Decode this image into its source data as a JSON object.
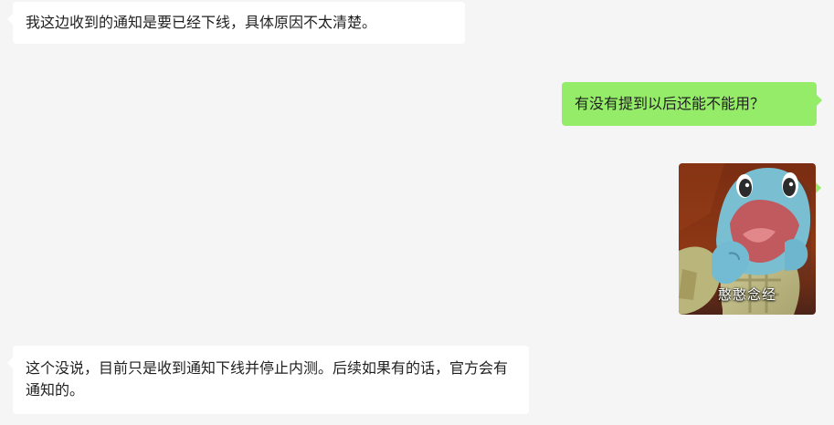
{
  "messages": [
    {
      "side": "left",
      "text": "我这边收到的通知是要已经下线，具体原因不太清楚。"
    },
    {
      "side": "right",
      "text": "有没有提到以后还能不能用？"
    },
    {
      "side": "right",
      "type": "sticker",
      "caption": "憨憨念经"
    },
    {
      "side": "left",
      "text": "这个没说，目前只是收到通知下线并停止内测。后续如果有的话，官方会有通知的。"
    }
  ],
  "colors": {
    "background": "#f5f5f5",
    "incoming_bubble": "#ffffff",
    "outgoing_bubble": "#95ec69"
  },
  "icons": {
    "sticker": "squirtle-sticker-icon"
  }
}
